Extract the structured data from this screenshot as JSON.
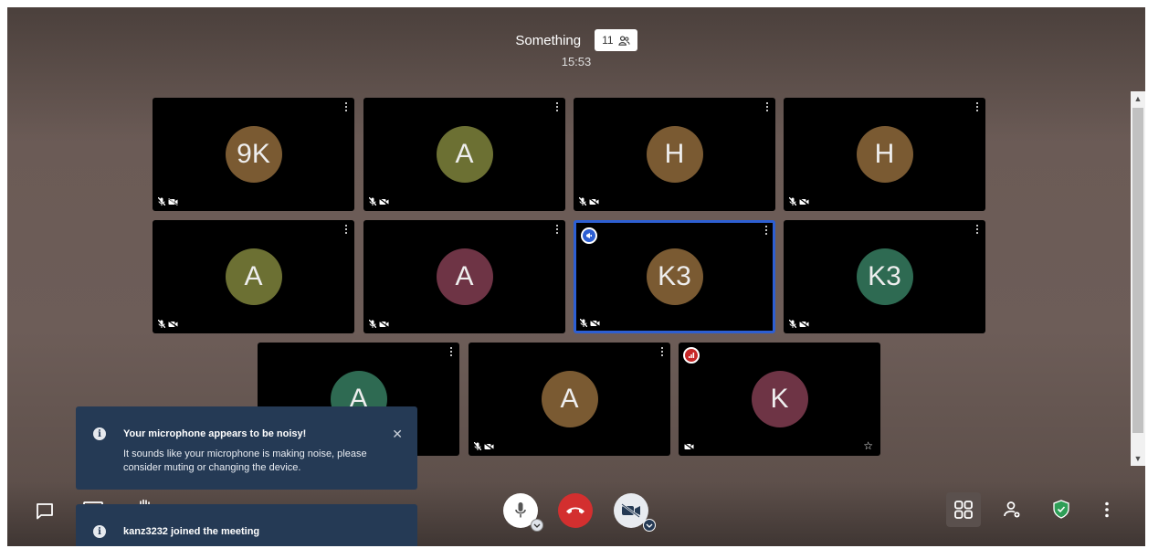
{
  "meeting": {
    "title": "Something",
    "participant_count": "11",
    "timer": "15:53"
  },
  "tiles": [
    {
      "initials": "9K",
      "color": "#7a5a32"
    },
    {
      "initials": "A",
      "color": "#6c7033"
    },
    {
      "initials": "H",
      "color": "#7a5a32"
    },
    {
      "initials": "H",
      "color": "#7a5a32"
    },
    {
      "initials": "A",
      "color": "#6c7033"
    },
    {
      "initials": "A",
      "color": "#6e3445"
    },
    {
      "initials": "K3",
      "color": "#7a5a32"
    },
    {
      "initials": "K3",
      "color": "#2e6a52"
    },
    {
      "initials": "A",
      "color": "#2e6a52"
    },
    {
      "initials": "A",
      "color": "#7a5a32"
    },
    {
      "initials": "K",
      "color": "#6e3445"
    }
  ],
  "notifications": {
    "noisy_mic": {
      "title": "Your microphone appears to be noisy!",
      "body": "It sounds like your microphone is making noise, please consider muting or changing the device."
    },
    "joined": {
      "title": "kanz3232 joined the meeting"
    }
  },
  "icons": {
    "info": "i",
    "close": "✕",
    "star": "☆",
    "scroll_up": "▲",
    "scroll_down": "▼"
  },
  "colors": {
    "active_border": "#2d5fd3",
    "hangup": "#d32f2f",
    "toast_bg": "#253a55",
    "security": "#2e9e57"
  }
}
